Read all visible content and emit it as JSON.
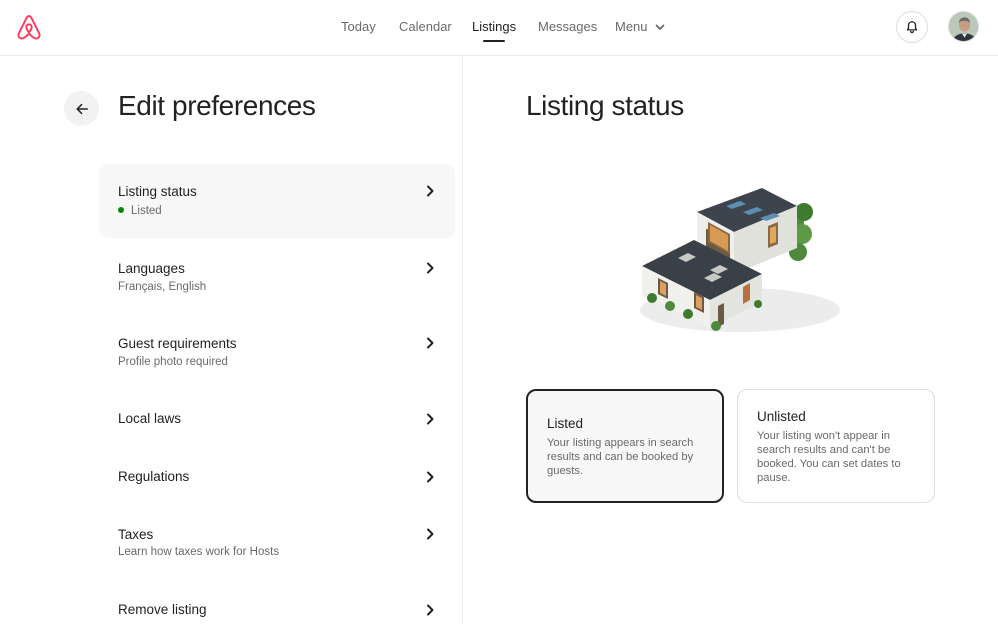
{
  "topbar": {
    "nav": [
      {
        "label": "Today"
      },
      {
        "label": "Calendar"
      },
      {
        "label": "Listings"
      },
      {
        "label": "Messages"
      },
      {
        "label": "Menu"
      }
    ],
    "active_nav": "Listings"
  },
  "left": {
    "title": "Edit preferences",
    "items": [
      {
        "label": "Listing status",
        "subtitle": "Listed",
        "status_color": "#008a05"
      },
      {
        "label": "Languages",
        "subtitle": "Français, English"
      },
      {
        "label": "Guest requirements",
        "subtitle": "Profile photo required"
      },
      {
        "label": "Local laws",
        "subtitle": ""
      },
      {
        "label": "Regulations",
        "subtitle": ""
      },
      {
        "label": "Taxes",
        "subtitle": "Learn how taxes work for Hosts"
      },
      {
        "label": "Remove listing",
        "subtitle": ""
      }
    ]
  },
  "right": {
    "title": "Listing status",
    "options": [
      {
        "title": "Listed",
        "description": "Your listing appears in search results and can be booked by guests."
      },
      {
        "title": "Unlisted",
        "description": "Your listing won't appear in search results and can't be booked. You can set dates to pause."
      }
    ],
    "selected_option": "Listed"
  },
  "colors": {
    "brand": "#ff385c",
    "text": "#222222",
    "muted": "#6a6a6a",
    "status_green": "#008a05"
  },
  "icons": [
    "airbnb-logo-icon",
    "chevron-down-icon",
    "bell-icon",
    "arrow-left-icon",
    "chevron-right-icon"
  ]
}
